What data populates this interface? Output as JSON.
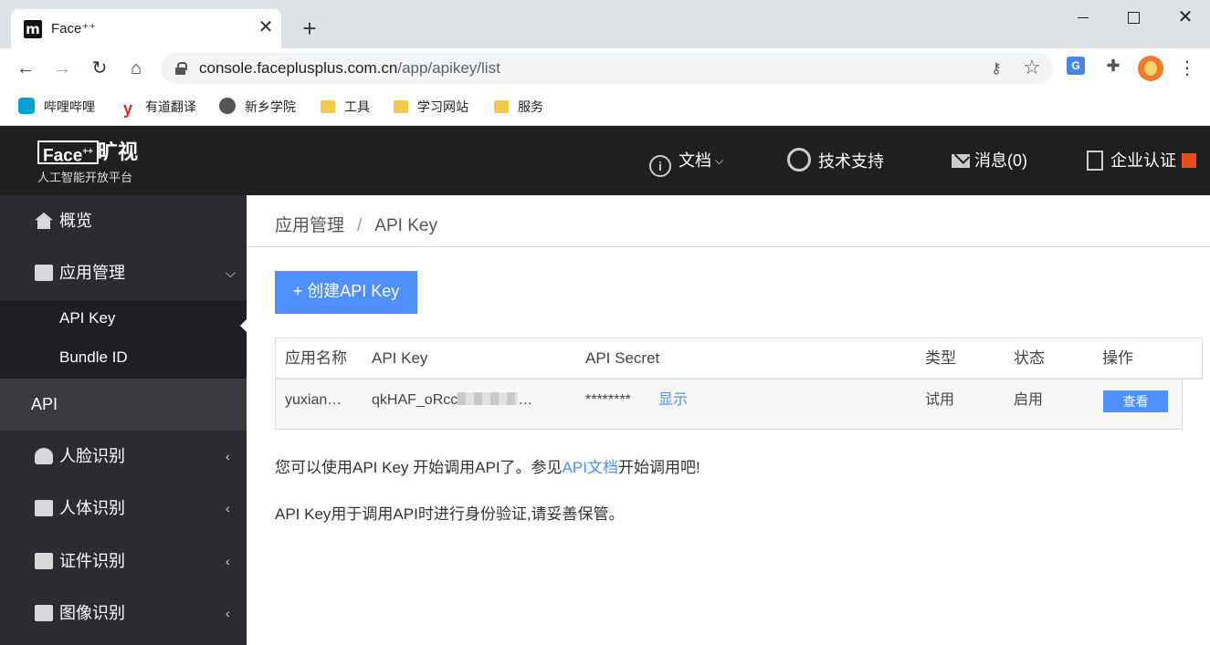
{
  "browser": {
    "tab_title": "Face⁺⁺",
    "favicon_text": "m",
    "url_host": "console.faceplusplus.com.cn",
    "url_path": "/app/apikey/list",
    "bookmarks": [
      "哔哩哔哩",
      "有道翻译",
      "新乡学院",
      "工具",
      "学习网站",
      "服务"
    ]
  },
  "header": {
    "logo_en": "Face",
    "logo_sup": "++",
    "logo_cn": "旷视",
    "logo_sub": "人工智能开放平台",
    "nav": [
      "文档",
      "技术支持",
      "消息(0)",
      "企业认证"
    ]
  },
  "sidebar": {
    "overview": "概览",
    "app_mgmt": "应用管理",
    "sub_items": [
      "API Key",
      "Bundle ID"
    ],
    "api_heading": "API",
    "groups": [
      "人脸识别",
      "人体识别",
      "证件识别",
      "图像识别"
    ]
  },
  "main": {
    "breadcrumb": [
      "应用管理",
      "/",
      "API Key"
    ],
    "create_button": "+ 创建API Key",
    "table": {
      "headers": [
        "应用名称",
        "API Key",
        "API Secret",
        "类型",
        "状态",
        "操作"
      ],
      "row": {
        "app_name": "yuxian…",
        "api_key_prefix": "qkHAF_oRcc",
        "api_key_suffix": "…",
        "api_secret": "********",
        "show_link": "显示",
        "type": "试用",
        "status": "启用",
        "action": "查看"
      }
    },
    "note1_before": "您可以使用API Key 开始调用API了。参见",
    "note1_link": "API文档",
    "note1_after": "开始调用吧!",
    "note2": "API Key用于调用API时进行身份验证,请妥善保管。"
  },
  "colors": {
    "accent": "#4d90fe",
    "header_bg": "#1f1f1f",
    "sidebar_bg": "#2b2c31"
  }
}
